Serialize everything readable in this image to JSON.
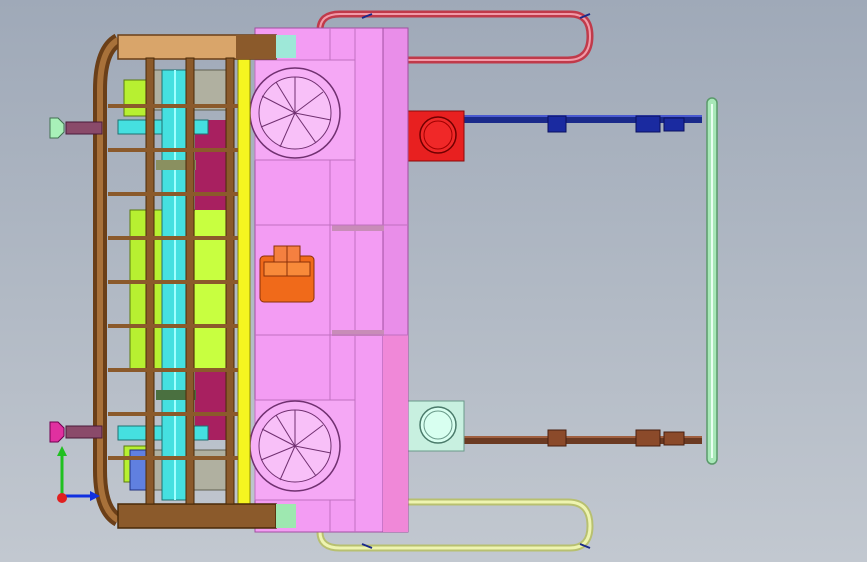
{
  "viewport": {
    "background_top": "#9fa9b8",
    "background_bottom": "#c2c8d0"
  },
  "model": {
    "description_parts": [
      "pink-housing",
      "wood-frame",
      "green-inner-assembly",
      "cyan-shaft",
      "fan-wheel-top",
      "fan-wheel-bottom",
      "red-motor-box",
      "mint-motor-box",
      "orange-control-box",
      "red-loop-handle",
      "yellow-loop-handle",
      "green-vertical-rail",
      "navy-rod",
      "brown-rod",
      "magenta-valve-top",
      "magenta-valve-bottom"
    ],
    "colors": {
      "housing": "#f39cf3",
      "housing_dark": "#e98ee9",
      "wood": "#8b5a2b",
      "wood_light": "#d9a56a",
      "lime": "#b7f031",
      "cyan": "#45e0e0",
      "red_box": "#e82020",
      "mint_box": "#c8f0e0",
      "orange_box": "#f06a1a",
      "red_handle": "#c03a4a",
      "yellow_handle": "#e8f0a0",
      "green_rail": "#a8e8b8",
      "navy": "#1a2a8a",
      "brown_rod": "#6b3a22",
      "magenta": "#e030a0",
      "yellow_strip": "#f5f520"
    }
  },
  "triad": {
    "axes": [
      "x-axis",
      "y-axis",
      "z-axis"
    ],
    "colors": {
      "x": "#1030e0",
      "y": "#20c020",
      "z": "#e02020"
    }
  }
}
